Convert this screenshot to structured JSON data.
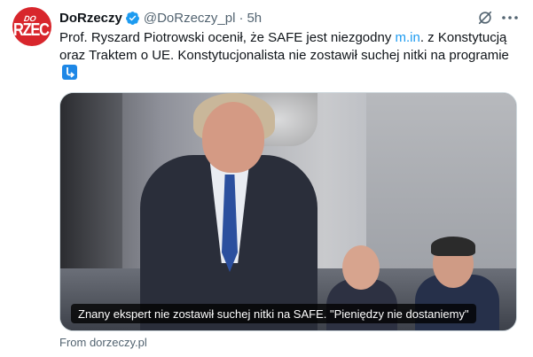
{
  "author": {
    "name": "DoRzeczy",
    "handle": "@DoRzeczy_pl",
    "separator": "·",
    "time": "5h",
    "avatar_text_top": "DO",
    "avatar_text_main": "RZEC",
    "avatar_color": "#d8262c"
  },
  "tweet": {
    "text_before_link": "Prof. Ryszard Piotrowski ocenił, że SAFE jest niezgodny ",
    "link_text": "m.in",
    "text_after_link": ". z Konstytucją oraz Traktem o UE. Konstytucjonalista nie zostawił suchej nitki na programie ",
    "emoji_icon": "arrow-heading-down-icon"
  },
  "media": {
    "caption": "Znany ekspert nie zostawił suchej nitki na SAFE. \"Pieniędzy nie dostaniemy\""
  },
  "card": {
    "source": "From dorzeczy.pl"
  },
  "colors": {
    "link": "#1d9bf0",
    "verified": "#1d9bf0",
    "secondary_text": "#536471"
  }
}
